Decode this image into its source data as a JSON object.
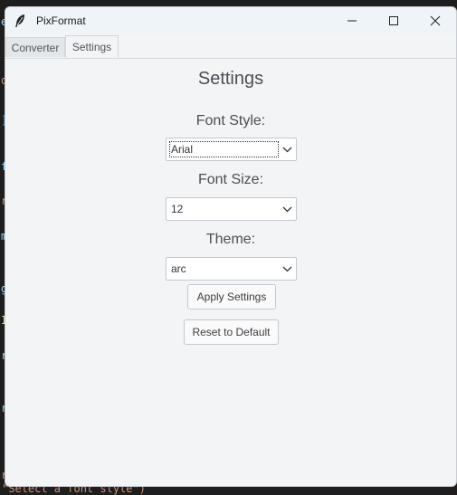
{
  "window": {
    "title": "PixFormat"
  },
  "tabs": [
    {
      "label": "Converter",
      "selected": false
    },
    {
      "label": "Settings",
      "selected": true
    }
  ],
  "settings": {
    "title": "Settings",
    "font_style": {
      "label": "Font Style:",
      "value": "Arial"
    },
    "font_size": {
      "label": "Font Size:",
      "value": "12"
    },
    "theme": {
      "label": "Theme:",
      "value": "arc"
    },
    "apply_label": "Apply Settings",
    "reset_label": "Reset to Default"
  },
  "background_editor": {
    "left_fragments": [
      "e",
      "or",
      "]",
      "r",
      "f",
      "m",
      "g",
      "I",
      "r",
      "r",
      "r"
    ],
    "bottom_line": "\"Select a font style\")"
  },
  "colors": {
    "window_bg": "#f3f4f6",
    "titlebar_bg": "#eef4f8",
    "editor_bg": "#1e1e1e"
  }
}
